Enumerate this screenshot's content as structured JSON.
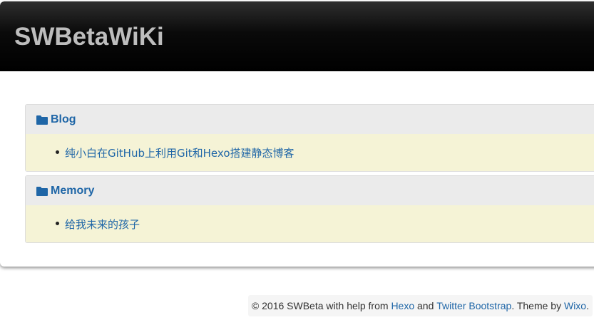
{
  "site": {
    "title": "SWBetaWiKi"
  },
  "categories": [
    {
      "name": "Blog",
      "posts": [
        "纯小白在GitHub上利用Git和Hexo搭建静态博客"
      ]
    },
    {
      "name": "Memory",
      "posts": [
        "给我未来的孩子"
      ]
    }
  ],
  "footer": {
    "prefix": "© 2016 SWBeta with help from ",
    "link_hexo": "Hexo",
    "and": " and ",
    "link_bootstrap": "Twitter Bootstrap",
    "theme_prefix": ". Theme by ",
    "link_theme": "Wixo",
    "suffix": "."
  },
  "colors": {
    "link": "#1f66a7",
    "header_bg": "#000000",
    "title": "#bdbdbd",
    "panel_heading_bg": "#ebebeb",
    "panel_body_bg": "#f5f3d6"
  },
  "icons": {
    "category": "folder-icon"
  }
}
